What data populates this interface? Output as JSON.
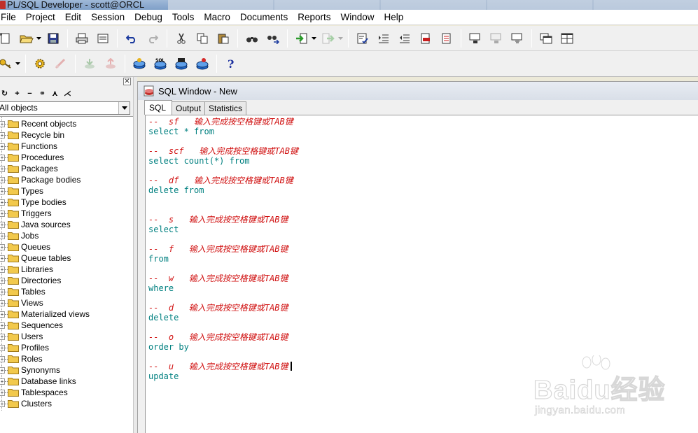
{
  "window": {
    "title": "PL/SQL Developer - scott@ORCL"
  },
  "menu": [
    "File",
    "Project",
    "Edit",
    "Session",
    "Debug",
    "Tools",
    "Macro",
    "Documents",
    "Reports",
    "Window",
    "Help"
  ],
  "left_pane": {
    "close_glyph": "✕",
    "filter_value": "All objects",
    "tree_items": [
      "Recent objects",
      "Recycle bin",
      "Functions",
      "Procedures",
      "Packages",
      "Package bodies",
      "Types",
      "Type bodies",
      "Triggers",
      "Java sources",
      "Jobs",
      "Queues",
      "Queue tables",
      "Libraries",
      "Directories",
      "Tables",
      "Views",
      "Materialized views",
      "Sequences",
      "Users",
      "Profiles",
      "Roles",
      "Synonyms",
      "Database links",
      "Tablespaces",
      "Clusters"
    ]
  },
  "sql_window": {
    "title": "SQL Window - New",
    "tabs": [
      "SQL",
      "Output",
      "Statistics"
    ],
    "code_lines": [
      {
        "text": "--  sf   输入完成按空格键或TAB键",
        "kind": "comment"
      },
      {
        "text": "select * from",
        "kind": "code"
      },
      {
        "text": "",
        "kind": "code"
      },
      {
        "text": "--  scf   输入完成按空格键或TAB键",
        "kind": "comment"
      },
      {
        "text": "select count(*) from",
        "kind": "code"
      },
      {
        "text": "",
        "kind": "code"
      },
      {
        "text": "--  df   输入完成按空格键或TAB键",
        "kind": "comment"
      },
      {
        "text": "delete from",
        "kind": "code"
      },
      {
        "text": "",
        "kind": "code"
      },
      {
        "text": "",
        "kind": "code"
      },
      {
        "text": "--  s   输入完成按空格键或TAB键",
        "kind": "comment"
      },
      {
        "text": "select",
        "kind": "code"
      },
      {
        "text": "",
        "kind": "code"
      },
      {
        "text": "--  f   输入完成按空格键或TAB键",
        "kind": "comment"
      },
      {
        "text": "from",
        "kind": "code"
      },
      {
        "text": "",
        "kind": "code"
      },
      {
        "text": "--  w   输入完成按空格键或TAB键",
        "kind": "comment"
      },
      {
        "text": "where",
        "kind": "code"
      },
      {
        "text": "",
        "kind": "code"
      },
      {
        "text": "--  d   输入完成按空格键或TAB键",
        "kind": "comment"
      },
      {
        "text": "delete",
        "kind": "code"
      },
      {
        "text": "",
        "kind": "code"
      },
      {
        "text": "--  o   输入完成按空格键或TAB键",
        "kind": "comment"
      },
      {
        "text": "order by",
        "kind": "code"
      },
      {
        "text": "",
        "kind": "code"
      },
      {
        "text": "--  u   输入完成按空格键或TAB键",
        "kind": "comment",
        "cursor": true
      },
      {
        "text": "update",
        "kind": "code"
      }
    ]
  },
  "watermark": {
    "brand": "Baidu经验",
    "url": "jingyan.baidu.com"
  },
  "colors": {
    "comment": "#d01010",
    "keyword": "#008080",
    "folder": "#f2c94c"
  }
}
